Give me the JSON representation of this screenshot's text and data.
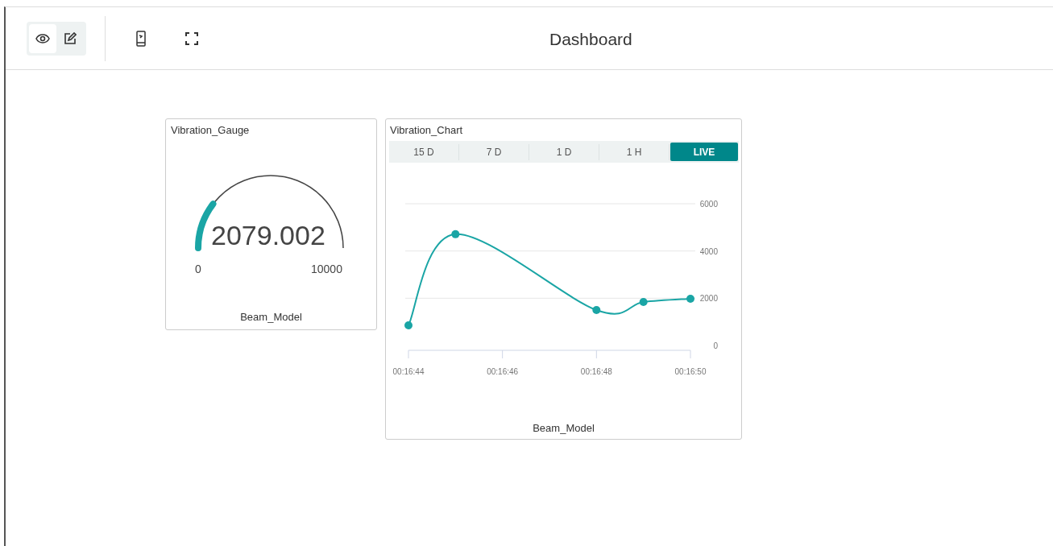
{
  "toolbar": {
    "mode_toggle": [
      {
        "kind": "view",
        "selected": true
      },
      {
        "kind": "edit",
        "selected": false
      }
    ],
    "actions": [
      {
        "kind": "phone"
      },
      {
        "kind": "fullscreen"
      }
    ],
    "title": "Dashboard"
  },
  "widgets": [
    {
      "kind": "gauge",
      "title": "Vibration_Gauge",
      "value": "2079.002",
      "min": "0",
      "max": "10000",
      "caption": "Beam_Model"
    },
    {
      "kind": "chart",
      "title": "Vibration_Chart",
      "ranges": [
        {
          "label": "15 D",
          "selected": false
        },
        {
          "label": "7 D",
          "selected": false
        },
        {
          "label": "1 D",
          "selected": false
        },
        {
          "label": "1 H",
          "selected": false
        },
        {
          "label": "LIVE",
          "selected": true
        }
      ],
      "chart_data": {
        "type": "line",
        "x": [
          1004,
          1005,
          1008,
          1009,
          1010
        ],
        "series": [
          {
            "name": "Beam_Model",
            "color": "#1aa5a5",
            "marker": true,
            "values": [
              850,
              4710,
              1500,
              1840,
              1980
            ]
          }
        ],
        "xlim": [
          1004,
          1010
        ],
        "ylim": [
          0,
          6000
        ],
        "xticks": [
          {
            "value": 1004,
            "label": "00:16:44"
          },
          {
            "value": 1006,
            "label": "00:16:46"
          },
          {
            "value": 1008,
            "label": "00:16:48"
          },
          {
            "value": 1010,
            "label": "00:16:50"
          }
        ],
        "yticks": [
          0,
          2000,
          4000,
          6000
        ]
      }
    }
  ]
}
